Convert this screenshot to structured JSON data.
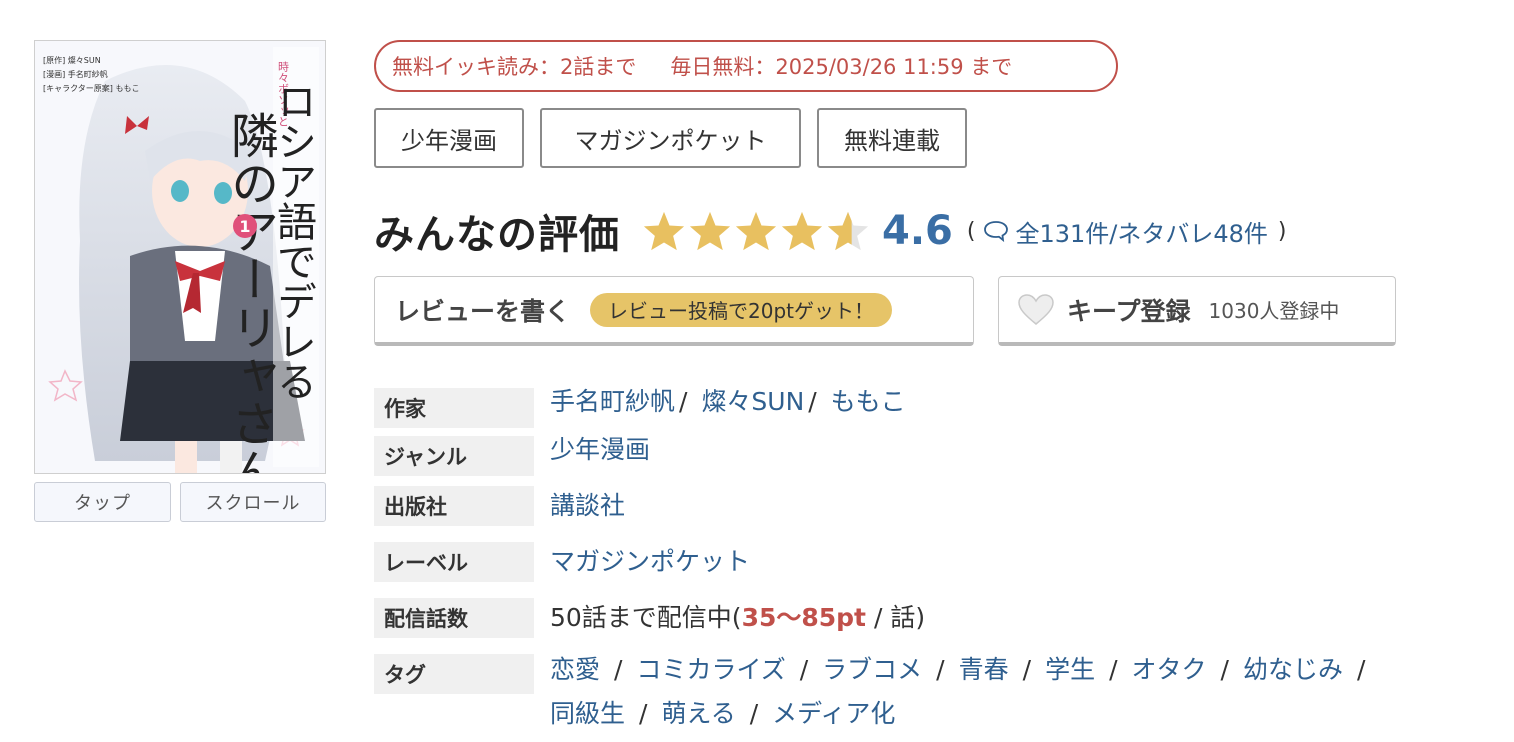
{
  "cover": {
    "title_line1": "ロシア語でデレる",
    "title_line2": "隣のアーリャさん",
    "small_title": "時々ボソッと",
    "credits": [
      "[原作] 燦々SUN",
      "[漫画] 手名町紗帆",
      "[キャラクター原案] ももこ"
    ],
    "volume": "1",
    "tap_label": "タップ",
    "scroll_label": "スクロール"
  },
  "free": {
    "ikki": "無料イッキ読み：2話まで",
    "daily": "毎日無料：2025/03/26 11:59 まで"
  },
  "chips": [
    "少年漫画",
    "マガジンポケット",
    "無料連載"
  ],
  "rating": {
    "title": "みんなの評価",
    "score": "4.6",
    "stars_value": 4.6,
    "open_paren": "(",
    "reviews_text": "全131件/ネタバレ48件",
    "close_paren": ")"
  },
  "review_button": {
    "label": "レビューを書く",
    "promo": "レビュー投稿で20ptゲット！"
  },
  "keep_button": {
    "label": "キープ登録",
    "count": "1030人登録中"
  },
  "details": {
    "author": {
      "label": "作家",
      "names": [
        "手名町紗帆",
        "燦々SUN",
        "ももこ"
      ],
      "sep": "/"
    },
    "genre": {
      "label": "ジャンル",
      "value": "少年漫画"
    },
    "publisher": {
      "label": "出版社",
      "value": "講談社"
    },
    "label": {
      "label": "レーベル",
      "value": "マガジンポケット"
    },
    "episodes": {
      "label": "配信話数",
      "prefix": "50話まで配信中(",
      "price": "35〜85pt",
      "suffix": " / 話)"
    },
    "tags": {
      "label": "タグ",
      "sep": "/",
      "line1": [
        "恋愛",
        "コミカライズ",
        "ラブコメ",
        "青春",
        "学生",
        "オタク",
        "幼なじみ"
      ],
      "line2": [
        "同級生",
        "萌える",
        "メディア化"
      ]
    }
  },
  "colors": {
    "accent_red": "#c0504a",
    "link_blue": "#2f5f8f",
    "star_gold": "#e8c060",
    "promo_gold": "#e6c468"
  }
}
